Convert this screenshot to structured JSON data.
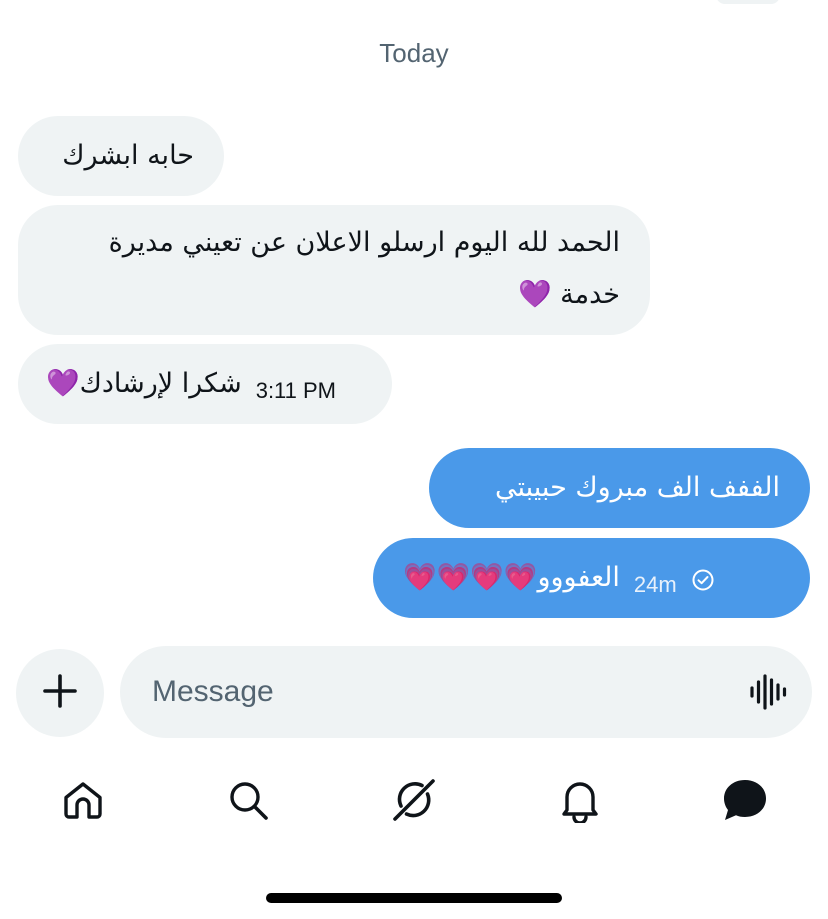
{
  "conversation": {
    "date_separator": "Today",
    "messages": [
      {
        "direction": "incoming",
        "text": "حابه ابشرك"
      },
      {
        "direction": "incoming",
        "text": "الحمد لله اليوم ارسلو الاعلان عن تعيني مديرة خدمة 💜"
      },
      {
        "direction": "incoming",
        "text": "شكرا لإرشادك💜",
        "time": "3:11 PM"
      },
      {
        "direction": "outgoing",
        "text": "الففف الف مبروك حبيبتي"
      },
      {
        "direction": "outgoing",
        "text": "العفووو💗💗💗💗",
        "time": "24m",
        "status_icon": "check-circle-icon"
      }
    ]
  },
  "composer": {
    "placeholder": "Message",
    "add_icon": "plus-icon",
    "voice_icon": "waveform-icon"
  },
  "bottom_nav": {
    "items": [
      {
        "name": "home",
        "icon": "home-icon"
      },
      {
        "name": "search",
        "icon": "search-icon"
      },
      {
        "name": "grok",
        "icon": "grok-icon"
      },
      {
        "name": "notifications",
        "icon": "bell-icon"
      },
      {
        "name": "messages",
        "icon": "message-icon",
        "active": true
      }
    ]
  },
  "colors": {
    "outgoing_bubble": "#4a99e9",
    "incoming_bubble": "#eff3f4",
    "text_primary": "#0f1419",
    "text_secondary": "#536471"
  }
}
